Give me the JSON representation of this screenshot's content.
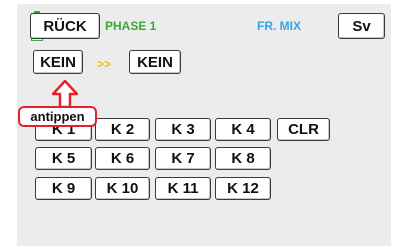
{
  "header": {
    "back_label": "RÜCK",
    "phase_label": "PHASE 1",
    "mix_label": "FR. MIX",
    "save_label": "Sv"
  },
  "mix_row": {
    "from_value": "KEIN",
    "arrow_glyph": ">>",
    "to_value": "KEIN"
  },
  "callout": {
    "text": "antippen"
  },
  "channels": [
    "K 1",
    "K 2",
    "K 3",
    "K 4",
    "K 5",
    "K 6",
    "K 7",
    "K 8",
    "K 9",
    "K 10",
    "K 11",
    "K 12"
  ],
  "clear_label": "CLR",
  "colors": {
    "battery_green": "#3aaa35",
    "phase_green": "#3aaa35",
    "mix_blue": "#2ea7e0",
    "arrow_yellow": "#e8c200",
    "callout_red": "#e8202a"
  },
  "icons": {
    "battery": "battery-icon",
    "pointer": "arrow-up-icon"
  }
}
